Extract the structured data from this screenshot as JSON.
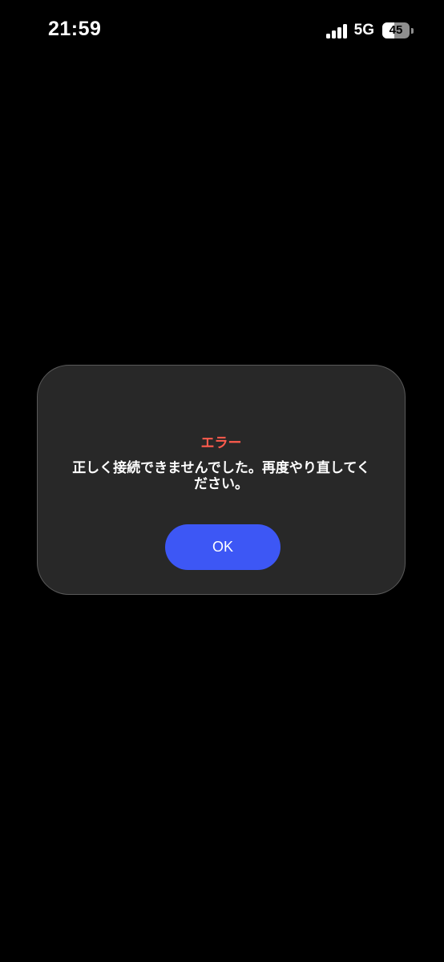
{
  "status_bar": {
    "time": "21:59",
    "network": "5G",
    "battery_level": "45",
    "battery_fraction": 0.45,
    "signal_icon": "cellular-signal-icon",
    "battery_icon": "battery-icon"
  },
  "dialog": {
    "title": "エラー",
    "message": "正しく接続できませんでした。再度やり直してください。",
    "ok_label": "OK"
  },
  "colors": {
    "background": "#000000",
    "dialog_background": "#282828",
    "title": "#ff5b4d",
    "button": "#3d57f5"
  }
}
